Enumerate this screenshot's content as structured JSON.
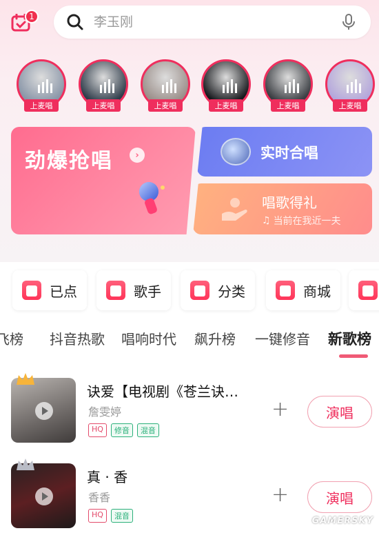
{
  "header": {
    "calendar_badge": "1",
    "search_placeholder": "李玉刚"
  },
  "avatars": [
    {
      "label": "上麦唱",
      "color": "#8a96a8"
    },
    {
      "label": "上麦唱",
      "color": "#2f3c4a"
    },
    {
      "label": "上麦唱",
      "color": "#9b8f8a"
    },
    {
      "label": "上麦唱",
      "color": "#16181c"
    },
    {
      "label": "上麦唱",
      "color": "#3a3d42"
    },
    {
      "label": "上麦唱",
      "color": "#b4a6dc"
    }
  ],
  "promo": {
    "main_title": "劲爆抢唱",
    "chorus_title": "实时合唱",
    "gift_title": "唱歌得礼",
    "gift_sub": "当前在我近一夫"
  },
  "quick": [
    {
      "label": "已点"
    },
    {
      "label": "歌手"
    },
    {
      "label": "分类"
    },
    {
      "label": "商城"
    }
  ],
  "tabs": {
    "items": [
      "飞榜",
      "抖音热歌",
      "唱响时代",
      "飙升榜",
      "一键修音",
      "新歌榜"
    ],
    "active": "新歌榜"
  },
  "songs": [
    {
      "title": "诀爱【电视剧《苍兰诀…",
      "artist": "詹雯婷",
      "tags": [
        "HQ",
        "修音",
        "混音"
      ],
      "action": "演唱"
    },
    {
      "title": "真 · 香",
      "artist": "香香",
      "tags": [
        "HQ",
        "混音"
      ],
      "action": "演唱"
    }
  ],
  "watermark": "GAMERSKY",
  "colors": {
    "accent": "#ef2e5d",
    "promo_main": "#ff7896",
    "promo_chorus": "#7485f3",
    "promo_gift": "#ffa184",
    "tag_green": "#2bb07a"
  }
}
